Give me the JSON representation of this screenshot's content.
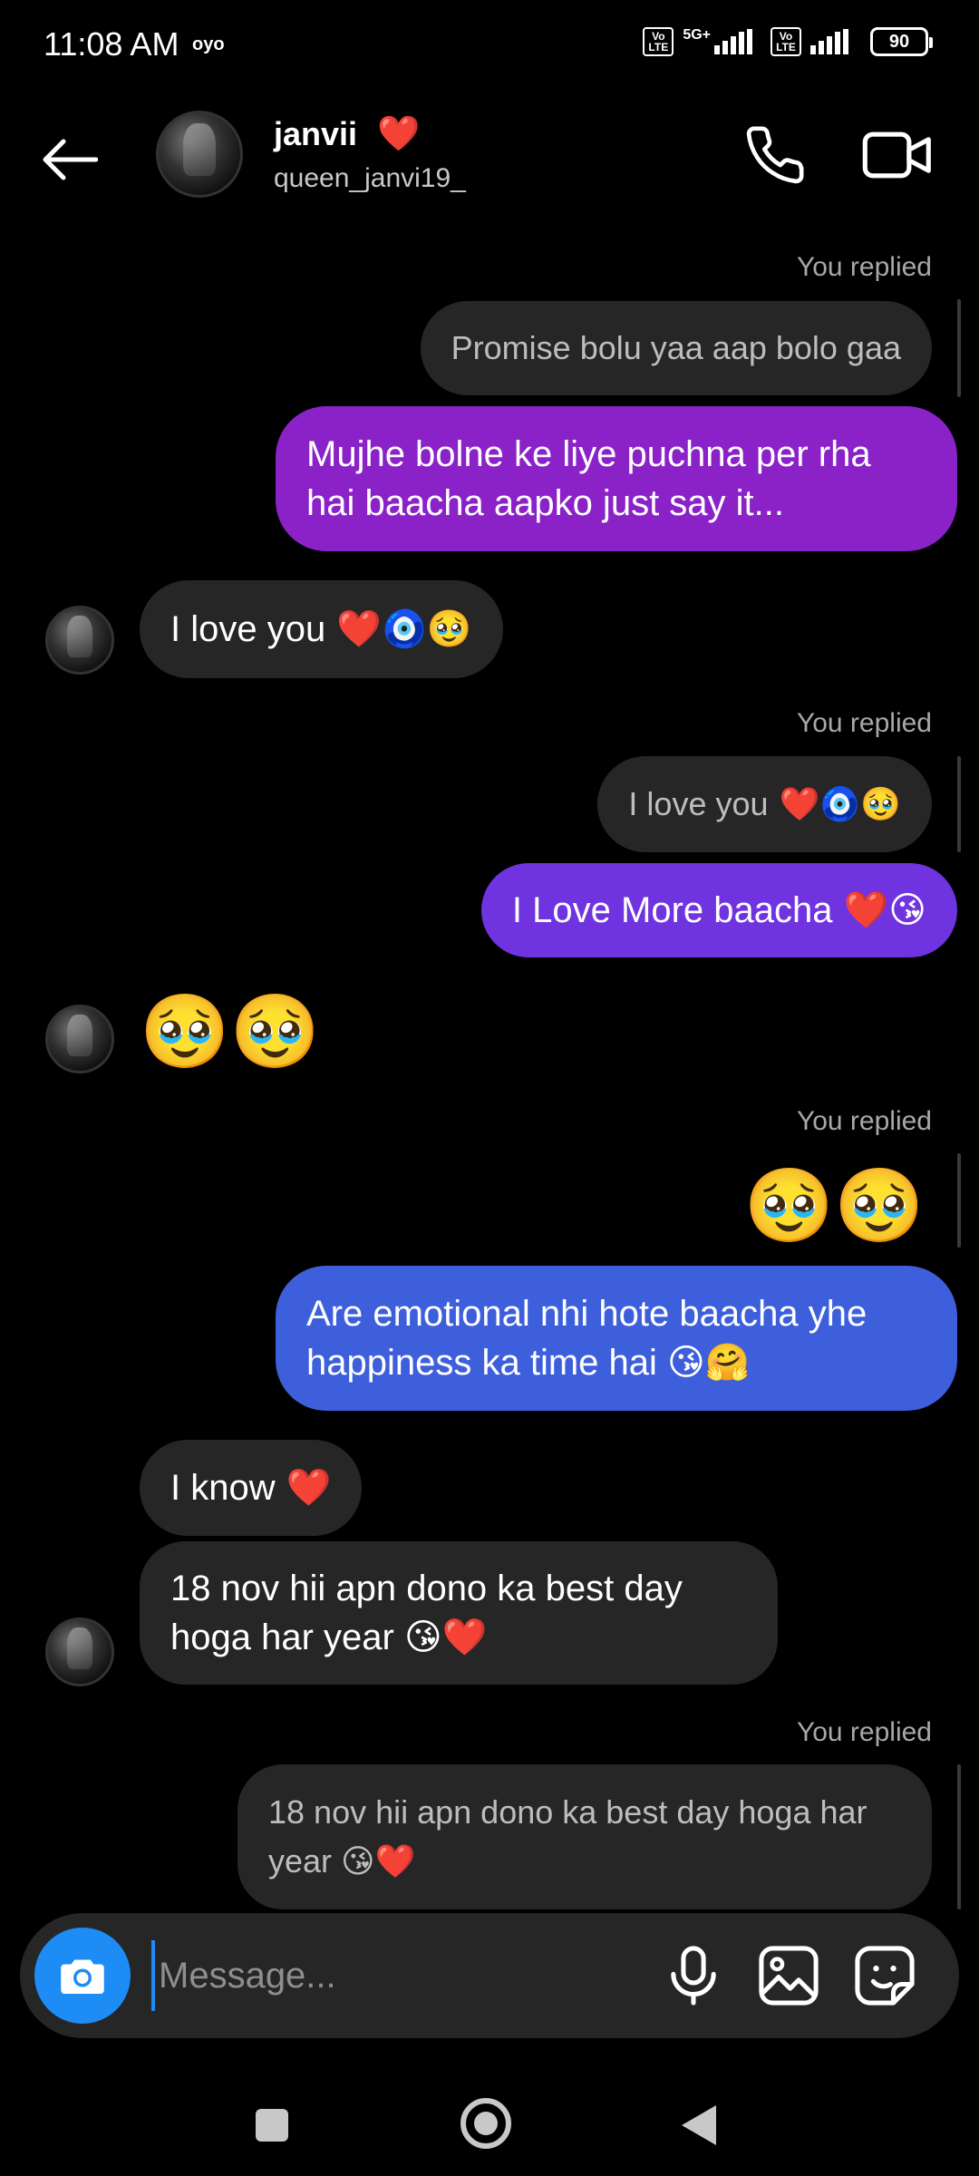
{
  "status_bar": {
    "time": "11:08 AM",
    "carrier_icon_text": "oyo",
    "lte1": "Vo LTE",
    "net1": "5G+",
    "lte2": "Vo LTE",
    "battery": "90"
  },
  "header": {
    "name": "janvii",
    "name_emoji": "❤️",
    "handle": "queen_janvi19_",
    "icons": [
      "back-arrow-icon",
      "phone-icon",
      "video-camera-icon"
    ]
  },
  "messages": [
    {
      "type": "replied_label",
      "text": "You replied"
    },
    {
      "type": "quote",
      "text": "Promise bolu yaa aap bolo gaa"
    },
    {
      "type": "sent",
      "text": "Mujhe bolne ke liye puchna per rha hai baacha aapko just say it...",
      "color": "#8a22c8"
    },
    {
      "type": "received",
      "text": "I love you",
      "emoji": "❤️🧿🥹"
    },
    {
      "type": "replied_label",
      "text": "You replied"
    },
    {
      "type": "quote",
      "text": "I love you",
      "emoji": "❤️🧿🥹"
    },
    {
      "type": "sent",
      "text": "I Love More baacha",
      "emoji": "❤️😘",
      "color": "#6f33e0"
    },
    {
      "type": "received_emoji",
      "emoji": "🥹🥹"
    },
    {
      "type": "replied_label",
      "text": "You replied"
    },
    {
      "type": "quote_emoji",
      "emoji": "🥹🥹"
    },
    {
      "type": "sent",
      "text": "Are emotional nhi hote baacha yhe happiness ka time hai",
      "emoji": "😘🤗",
      "color": "#3e5fdc"
    },
    {
      "type": "received",
      "text": "I know",
      "emoji": "❤️"
    },
    {
      "type": "received",
      "text": "18 nov  hii apn dono ka best day hoga har year",
      "emoji": "😘❤️"
    },
    {
      "type": "replied_label",
      "text": "You replied"
    },
    {
      "type": "quote",
      "text": "18 nov  hii apn dono ka best day hoga har year",
      "emoji": "😘❤️"
    }
  ],
  "composer": {
    "placeholder": "Message...",
    "camera_color": "#1d8cf5",
    "icons": [
      "camera-icon",
      "microphone-icon",
      "gallery-icon",
      "sticker-icon"
    ]
  },
  "nav_bar": {
    "icons": [
      "recent-apps-icon",
      "home-icon",
      "back-icon"
    ]
  }
}
